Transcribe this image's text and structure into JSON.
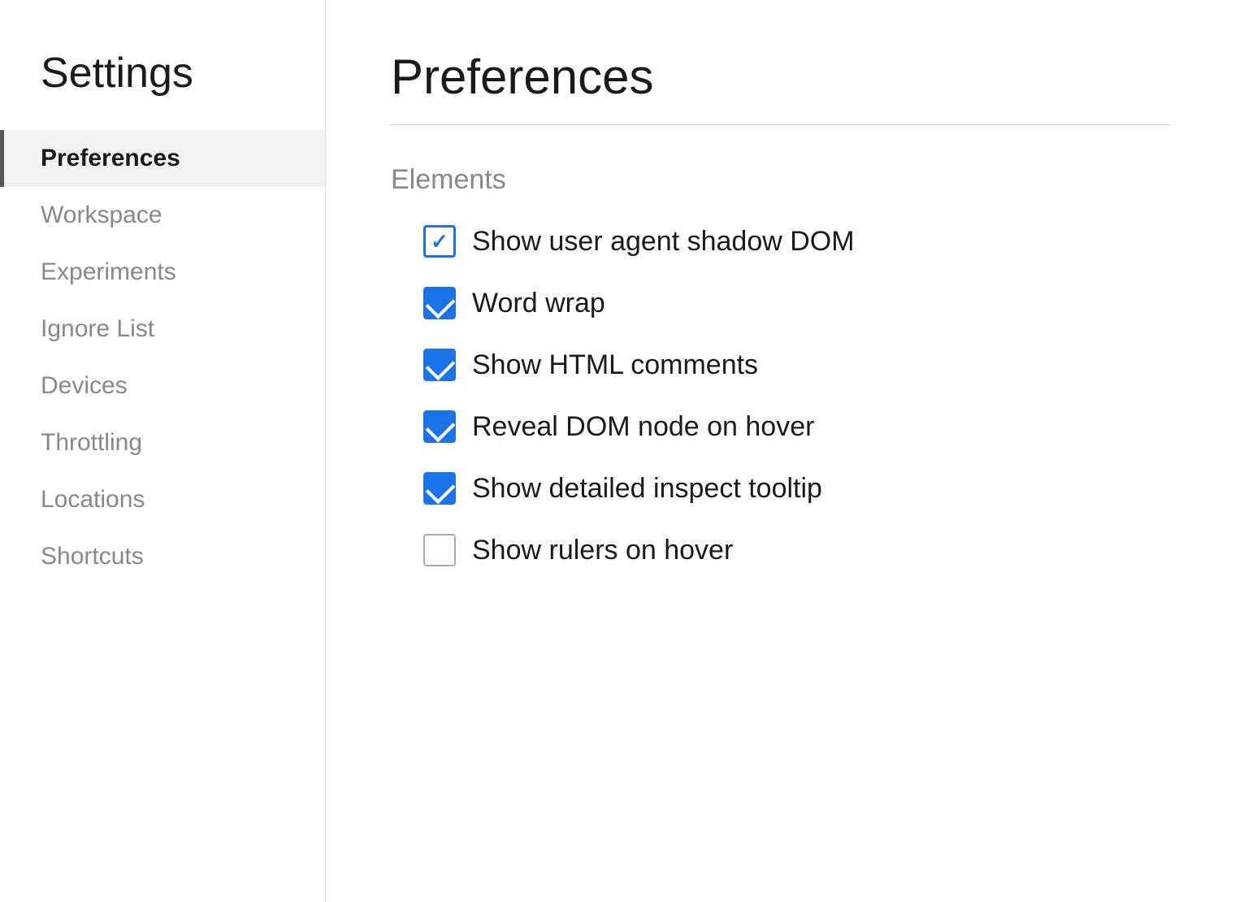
{
  "sidebar": {
    "title": "Settings",
    "items": [
      {
        "id": "preferences",
        "label": "Preferences",
        "active": true
      },
      {
        "id": "workspace",
        "label": "Workspace",
        "active": false
      },
      {
        "id": "experiments",
        "label": "Experiments",
        "active": false
      },
      {
        "id": "ignore-list",
        "label": "Ignore List",
        "active": false
      },
      {
        "id": "devices",
        "label": "Devices",
        "active": false
      },
      {
        "id": "throttling",
        "label": "Throttling",
        "active": false
      },
      {
        "id": "locations",
        "label": "Locations",
        "active": false
      },
      {
        "id": "shortcuts",
        "label": "Shortcuts",
        "active": false
      }
    ]
  },
  "main": {
    "page_title": "Preferences",
    "sections": [
      {
        "title": "Elements",
        "checkboxes": [
          {
            "id": "shadow-dom",
            "label": "Show user agent shadow DOM",
            "checked": true,
            "outlined": true
          },
          {
            "id": "word-wrap",
            "label": "Word wrap",
            "checked": true,
            "outlined": false
          },
          {
            "id": "html-comments",
            "label": "Show HTML comments",
            "checked": true,
            "outlined": false
          },
          {
            "id": "reveal-dom",
            "label": "Reveal DOM node on hover",
            "checked": true,
            "outlined": false
          },
          {
            "id": "inspect-tooltip",
            "label": "Show detailed inspect tooltip",
            "checked": true,
            "outlined": false
          },
          {
            "id": "rulers",
            "label": "Show rulers on hover",
            "checked": false,
            "outlined": false
          }
        ]
      }
    ]
  }
}
